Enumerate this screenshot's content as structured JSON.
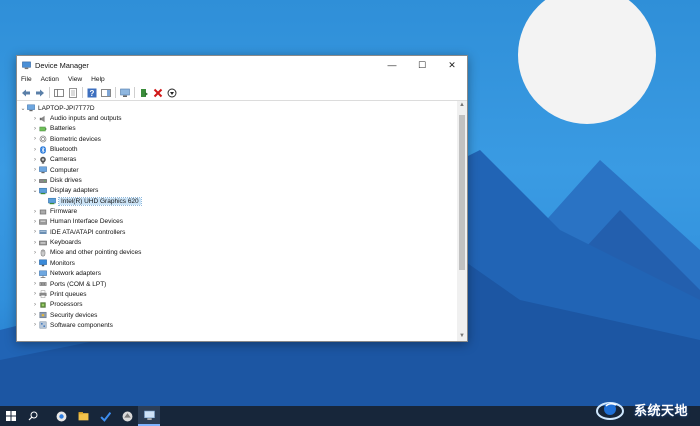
{
  "window": {
    "title": "Device Manager",
    "controls": {
      "minimize": "—",
      "maximize": "☐",
      "close": "✕"
    }
  },
  "menu": [
    "File",
    "Action",
    "View",
    "Help"
  ],
  "toolbar_icons": [
    "back-icon",
    "forward-icon",
    "console-tree-icon",
    "properties-icon",
    "help-icon",
    "action-pane-icon",
    "scan-hardware-icon",
    "update-driver-icon",
    "uninstall-icon",
    "disable-icon"
  ],
  "tree": {
    "root": "LAPTOP-JPI7T77D",
    "categories": [
      {
        "label": "Audio inputs and outputs",
        "icon": "speaker-icon"
      },
      {
        "label": "Batteries",
        "icon": "battery-icon"
      },
      {
        "label": "Biometric devices",
        "icon": "fingerprint-icon"
      },
      {
        "label": "Bluetooth",
        "icon": "bluetooth-icon"
      },
      {
        "label": "Cameras",
        "icon": "camera-icon"
      },
      {
        "label": "Computer",
        "icon": "computer-icon"
      },
      {
        "label": "Disk drives",
        "icon": "disk-icon"
      },
      {
        "label": "Display adapters",
        "icon": "display-adapter-icon",
        "expanded": true
      },
      {
        "label": "Intel(R) UHD Graphics 620",
        "icon": "display-adapter-icon",
        "child": true,
        "selected": true
      },
      {
        "label": "Firmware",
        "icon": "firmware-icon"
      },
      {
        "label": "Human Interface Devices",
        "icon": "hid-icon"
      },
      {
        "label": "IDE ATA/ATAPI controllers",
        "icon": "ide-icon"
      },
      {
        "label": "Keyboards",
        "icon": "keyboard-icon"
      },
      {
        "label": "Mice and other pointing devices",
        "icon": "mouse-icon"
      },
      {
        "label": "Monitors",
        "icon": "monitor-icon"
      },
      {
        "label": "Network adapters",
        "icon": "network-icon"
      },
      {
        "label": "Ports (COM & LPT)",
        "icon": "port-icon"
      },
      {
        "label": "Print queues",
        "icon": "printer-icon"
      },
      {
        "label": "Processors",
        "icon": "processor-icon"
      },
      {
        "label": "Security devices",
        "icon": "security-icon"
      },
      {
        "label": "Software components",
        "icon": "software-icon"
      }
    ]
  },
  "watermark": "系统天地",
  "colors": {
    "accent": "#0078d7",
    "selection": "#cce4f7",
    "taskbar": "#17263a"
  }
}
